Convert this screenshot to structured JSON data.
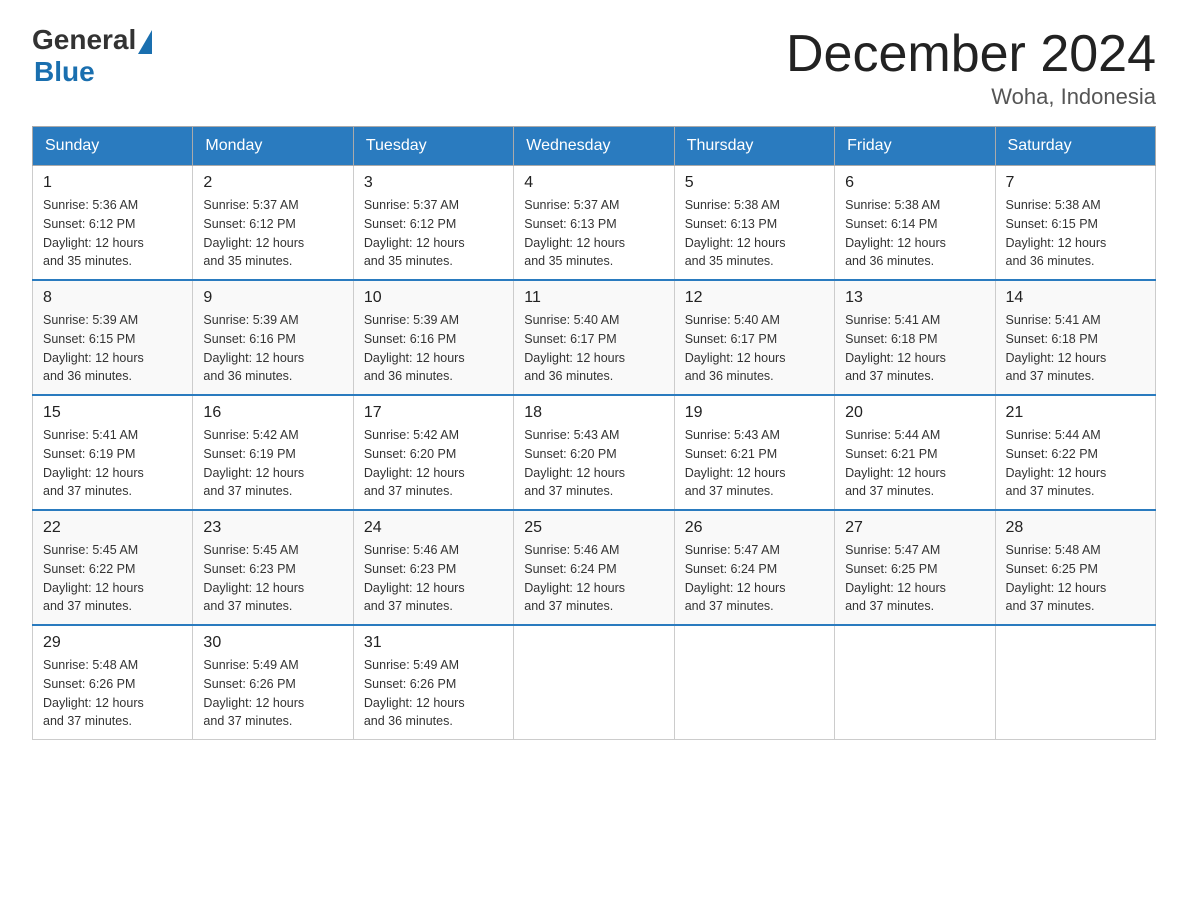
{
  "logo": {
    "text_general": "General",
    "text_blue": "Blue"
  },
  "title": {
    "month_year": "December 2024",
    "location": "Woha, Indonesia"
  },
  "headers": [
    "Sunday",
    "Monday",
    "Tuesday",
    "Wednesday",
    "Thursday",
    "Friday",
    "Saturday"
  ],
  "weeks": [
    [
      {
        "day": "1",
        "sunrise": "5:36 AM",
        "sunset": "6:12 PM",
        "daylight": "12 hours and 35 minutes."
      },
      {
        "day": "2",
        "sunrise": "5:37 AM",
        "sunset": "6:12 PM",
        "daylight": "12 hours and 35 minutes."
      },
      {
        "day": "3",
        "sunrise": "5:37 AM",
        "sunset": "6:12 PM",
        "daylight": "12 hours and 35 minutes."
      },
      {
        "day": "4",
        "sunrise": "5:37 AM",
        "sunset": "6:13 PM",
        "daylight": "12 hours and 35 minutes."
      },
      {
        "day": "5",
        "sunrise": "5:38 AM",
        "sunset": "6:13 PM",
        "daylight": "12 hours and 35 minutes."
      },
      {
        "day": "6",
        "sunrise": "5:38 AM",
        "sunset": "6:14 PM",
        "daylight": "12 hours and 36 minutes."
      },
      {
        "day": "7",
        "sunrise": "5:38 AM",
        "sunset": "6:15 PM",
        "daylight": "12 hours and 36 minutes."
      }
    ],
    [
      {
        "day": "8",
        "sunrise": "5:39 AM",
        "sunset": "6:15 PM",
        "daylight": "12 hours and 36 minutes."
      },
      {
        "day": "9",
        "sunrise": "5:39 AM",
        "sunset": "6:16 PM",
        "daylight": "12 hours and 36 minutes."
      },
      {
        "day": "10",
        "sunrise": "5:39 AM",
        "sunset": "6:16 PM",
        "daylight": "12 hours and 36 minutes."
      },
      {
        "day": "11",
        "sunrise": "5:40 AM",
        "sunset": "6:17 PM",
        "daylight": "12 hours and 36 minutes."
      },
      {
        "day": "12",
        "sunrise": "5:40 AM",
        "sunset": "6:17 PM",
        "daylight": "12 hours and 36 minutes."
      },
      {
        "day": "13",
        "sunrise": "5:41 AM",
        "sunset": "6:18 PM",
        "daylight": "12 hours and 37 minutes."
      },
      {
        "day": "14",
        "sunrise": "5:41 AM",
        "sunset": "6:18 PM",
        "daylight": "12 hours and 37 minutes."
      }
    ],
    [
      {
        "day": "15",
        "sunrise": "5:41 AM",
        "sunset": "6:19 PM",
        "daylight": "12 hours and 37 minutes."
      },
      {
        "day": "16",
        "sunrise": "5:42 AM",
        "sunset": "6:19 PM",
        "daylight": "12 hours and 37 minutes."
      },
      {
        "day": "17",
        "sunrise": "5:42 AM",
        "sunset": "6:20 PM",
        "daylight": "12 hours and 37 minutes."
      },
      {
        "day": "18",
        "sunrise": "5:43 AM",
        "sunset": "6:20 PM",
        "daylight": "12 hours and 37 minutes."
      },
      {
        "day": "19",
        "sunrise": "5:43 AM",
        "sunset": "6:21 PM",
        "daylight": "12 hours and 37 minutes."
      },
      {
        "day": "20",
        "sunrise": "5:44 AM",
        "sunset": "6:21 PM",
        "daylight": "12 hours and 37 minutes."
      },
      {
        "day": "21",
        "sunrise": "5:44 AM",
        "sunset": "6:22 PM",
        "daylight": "12 hours and 37 minutes."
      }
    ],
    [
      {
        "day": "22",
        "sunrise": "5:45 AM",
        "sunset": "6:22 PM",
        "daylight": "12 hours and 37 minutes."
      },
      {
        "day": "23",
        "sunrise": "5:45 AM",
        "sunset": "6:23 PM",
        "daylight": "12 hours and 37 minutes."
      },
      {
        "day": "24",
        "sunrise": "5:46 AM",
        "sunset": "6:23 PM",
        "daylight": "12 hours and 37 minutes."
      },
      {
        "day": "25",
        "sunrise": "5:46 AM",
        "sunset": "6:24 PM",
        "daylight": "12 hours and 37 minutes."
      },
      {
        "day": "26",
        "sunrise": "5:47 AM",
        "sunset": "6:24 PM",
        "daylight": "12 hours and 37 minutes."
      },
      {
        "day": "27",
        "sunrise": "5:47 AM",
        "sunset": "6:25 PM",
        "daylight": "12 hours and 37 minutes."
      },
      {
        "day": "28",
        "sunrise": "5:48 AM",
        "sunset": "6:25 PM",
        "daylight": "12 hours and 37 minutes."
      }
    ],
    [
      {
        "day": "29",
        "sunrise": "5:48 AM",
        "sunset": "6:26 PM",
        "daylight": "12 hours and 37 minutes."
      },
      {
        "day": "30",
        "sunrise": "5:49 AM",
        "sunset": "6:26 PM",
        "daylight": "12 hours and 37 minutes."
      },
      {
        "day": "31",
        "sunrise": "5:49 AM",
        "sunset": "6:26 PM",
        "daylight": "12 hours and 36 minutes."
      },
      null,
      null,
      null,
      null
    ]
  ],
  "labels": {
    "sunrise": "Sunrise:",
    "sunset": "Sunset:",
    "daylight": "Daylight:"
  }
}
